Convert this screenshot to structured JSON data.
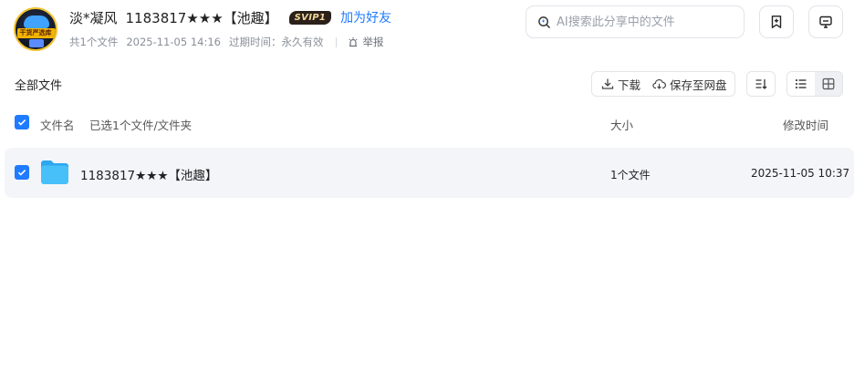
{
  "header": {
    "avatar_text": "干货严选库",
    "username": "淡*凝风",
    "share_title": "1183817★★★【池趣】",
    "svip_badge": "SVIP1",
    "add_friend": "加为好友",
    "file_count": "共1个文件",
    "share_time": "2025-11-05 14:16",
    "expire_label": "过期时间：永久有效",
    "report": "举报"
  },
  "search": {
    "placeholder": "AI搜索此分享中的文件",
    "value": ""
  },
  "toolbar": {
    "all_files": "全部文件",
    "download": "下载",
    "save_to_drive": "保存至网盘"
  },
  "table": {
    "headers": {
      "name": "文件名",
      "selected": "已选1个文件/文件夹",
      "size": "大小",
      "modified": "修改时间"
    },
    "rows": [
      {
        "name": "1183817★★★【池趣】",
        "size": "1个文件",
        "modified": "2025-11-05 10:37",
        "checked": true,
        "icon": "folder-icon"
      }
    ]
  },
  "colors": {
    "accent": "#1f7bff",
    "row_bg": "#f4f5f8",
    "folder": "#3fb6f5"
  }
}
